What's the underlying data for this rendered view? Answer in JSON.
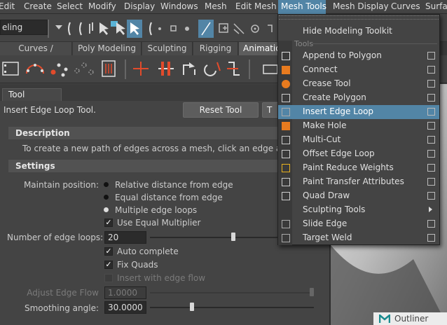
{
  "menubar": {
    "items": [
      "Edit",
      "Create",
      "Select",
      "Modify",
      "Display",
      "Windows",
      "Mesh",
      "Edit Mesh",
      "Mesh Tools",
      "Mesh Display",
      "Curves",
      "Surfaces"
    ],
    "active_index": 8
  },
  "status_line": {
    "mode": "Modeling",
    "mode_visible": "eling"
  },
  "shelf": {
    "tabs": [
      "Curves / Surfaces",
      "Poly Modeling",
      "Sculpting",
      "Rigging",
      "Animation"
    ],
    "active_tab": "Animation",
    "active_tab_visible": "Animatio"
  },
  "tool_settings": {
    "tab_label": "Tool Settings",
    "tool_name": "Insert Edge Loop Tool.",
    "reset_label": "Reset Tool",
    "tool_help_label": "T",
    "description": {
      "header": "Description",
      "text": "To create a new path of edges across a mesh, click an edge and drag."
    },
    "settings": {
      "header": "Settings",
      "maintain_position_label": "Maintain position:",
      "options": [
        "Relative distance from edge",
        "Equal distance from edge",
        "Multiple edge loops"
      ],
      "selected_option": "Multiple edge loops",
      "use_equal_multiplier": {
        "label": "Use Equal Multiplier",
        "checked": true
      },
      "num_edge_loops": {
        "label": "Number of edge loops:",
        "value": "20",
        "slider_fraction": 0.65
      },
      "auto_complete": {
        "label": "Auto complete",
        "checked": true
      },
      "fix_quads": {
        "label": "Fix Quads",
        "checked": true
      },
      "insert_with_edge_flow": {
        "label": "Insert with edge flow",
        "checked": false,
        "enabled": false
      },
      "adjust_edge_flow": {
        "label": "Adjust Edge Flow",
        "value": "1.0000",
        "enabled": false,
        "slider_fraction": 1.0
      },
      "smoothing_angle": {
        "label": "Smoothing angle:",
        "value": "30.0000",
        "slider_fraction": 0.25
      }
    }
  },
  "dropdown": {
    "title": "Mesh Tools",
    "hide_toolkit": "Hide Modeling Toolkit",
    "section_label": "Tools",
    "items": [
      {
        "label": "Append to Polygon",
        "icon": "append-polygon-icon",
        "option_box": true
      },
      {
        "label": "Connect",
        "icon": "connect-icon",
        "option_box": true
      },
      {
        "label": "Crease Tool",
        "icon": "crease-icon",
        "option_box": true
      },
      {
        "label": "Create Polygon",
        "icon": "create-polygon-icon",
        "option_box": true
      },
      {
        "label": "Insert Edge Loop",
        "icon": "insert-edge-loop-icon",
        "option_box": true,
        "highlighted": true
      },
      {
        "label": "Make Hole",
        "icon": "make-hole-icon",
        "option_box": true
      },
      {
        "label": "Multi-Cut",
        "icon": "multi-cut-icon",
        "option_box": true
      },
      {
        "label": "Offset Edge Loop",
        "icon": "offset-edge-loop-icon",
        "option_box": true
      },
      {
        "label": "Paint Reduce Weights",
        "icon": "paint-reduce-weights-icon",
        "option_box": true
      },
      {
        "label": "Paint Transfer Attributes",
        "icon": "paint-transfer-icon",
        "option_box": true
      },
      {
        "label": "Quad Draw",
        "icon": "quad-draw-icon",
        "option_box": true
      },
      {
        "label": "Sculpting Tools",
        "icon": "",
        "submenu": true
      },
      {
        "label": "Slide Edge",
        "icon": "slide-edge-icon",
        "option_box": true
      },
      {
        "label": "Target Weld",
        "icon": "target-weld-icon",
        "option_box": true
      }
    ]
  },
  "outliner": {
    "label": "Outliner"
  },
  "colors": {
    "highlight": "#5285a6",
    "panel": "#444444",
    "orange": "#e87b1f",
    "red_accent": "#e24b2b"
  }
}
